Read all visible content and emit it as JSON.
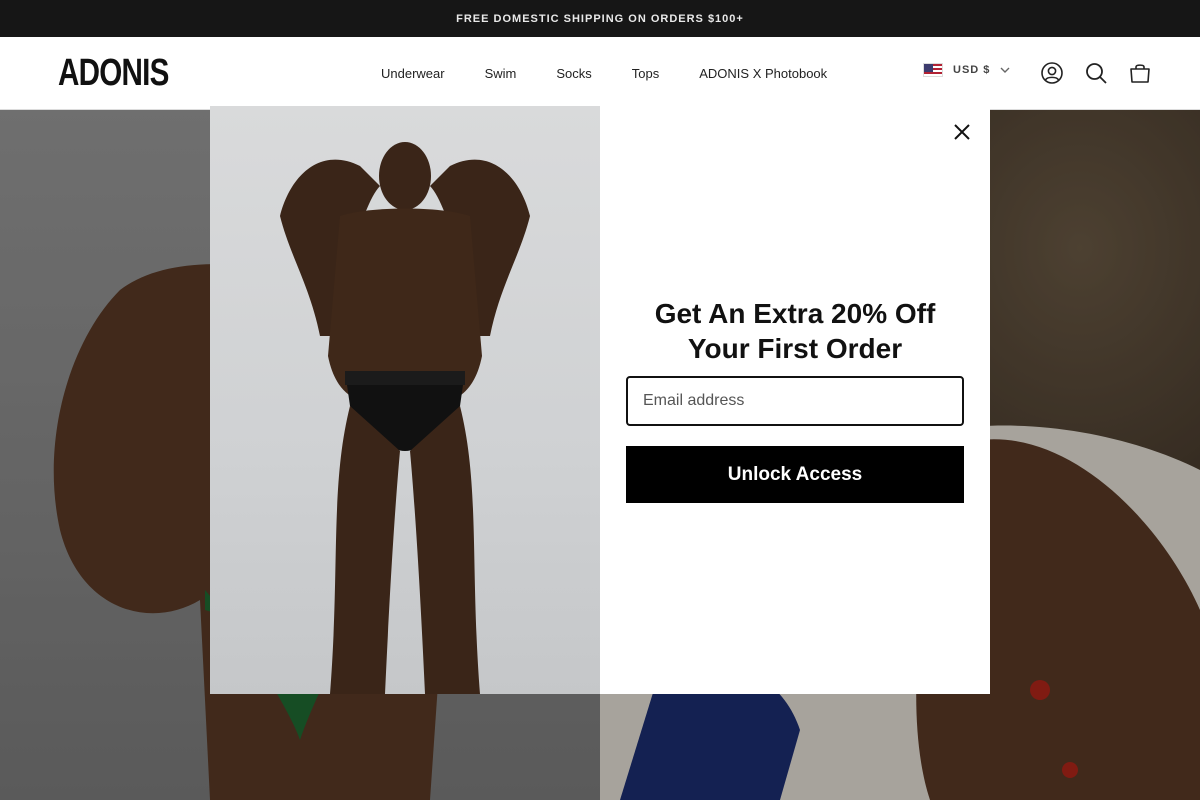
{
  "announcement": {
    "text": "FREE DOMESTIC SHIPPING ON ORDERS $100+"
  },
  "header": {
    "logo": "ADONIS",
    "nav": [
      "Underwear",
      "Swim",
      "Socks",
      "Tops",
      "ADONIS X Photobook"
    ],
    "currency": "USD $",
    "icons": [
      "account-icon",
      "search-icon",
      "cart-icon"
    ]
  },
  "modal": {
    "headline_line1": "Get An Extra 20% Off",
    "headline_line2": "Your First Order",
    "email_placeholder": "Email address",
    "email_value": "",
    "cta_label": "Unlock Access"
  },
  "colors": {
    "announcement_bg": "#161616",
    "cta_bg": "#000000",
    "header_bg": "#ffffff"
  }
}
